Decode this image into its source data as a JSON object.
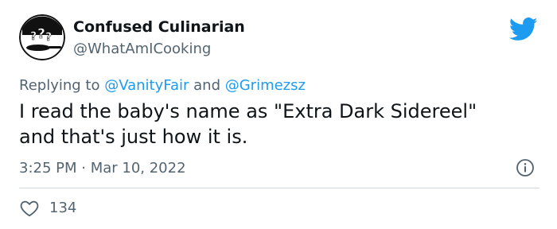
{
  "author": {
    "display_name": "Confused Culinarian",
    "handle": "@WhatAmICooking",
    "avatar_icon": "confused-pan-avatar"
  },
  "reply": {
    "prefix": "Replying to ",
    "mention_1": "@VanityFair",
    "conjunction": " and ",
    "mention_2": "@Grimezsz"
  },
  "tweet": {
    "line_1": "I read the baby's name as \"Extra Dark Sidereel\"",
    "line_2": "and that's just how it is."
  },
  "meta": {
    "time": "3:25 PM",
    "separator": " · ",
    "date": "Mar 10, 2022"
  },
  "engagement": {
    "like_count": "134"
  },
  "icons": {
    "brand": "twitter-bird-icon",
    "info": "info-icon",
    "like": "heart-icon"
  },
  "colors": {
    "brand": "#1d9bf0",
    "text": "#0f1419",
    "secondary": "#536471",
    "divider": "#cfd9de"
  }
}
